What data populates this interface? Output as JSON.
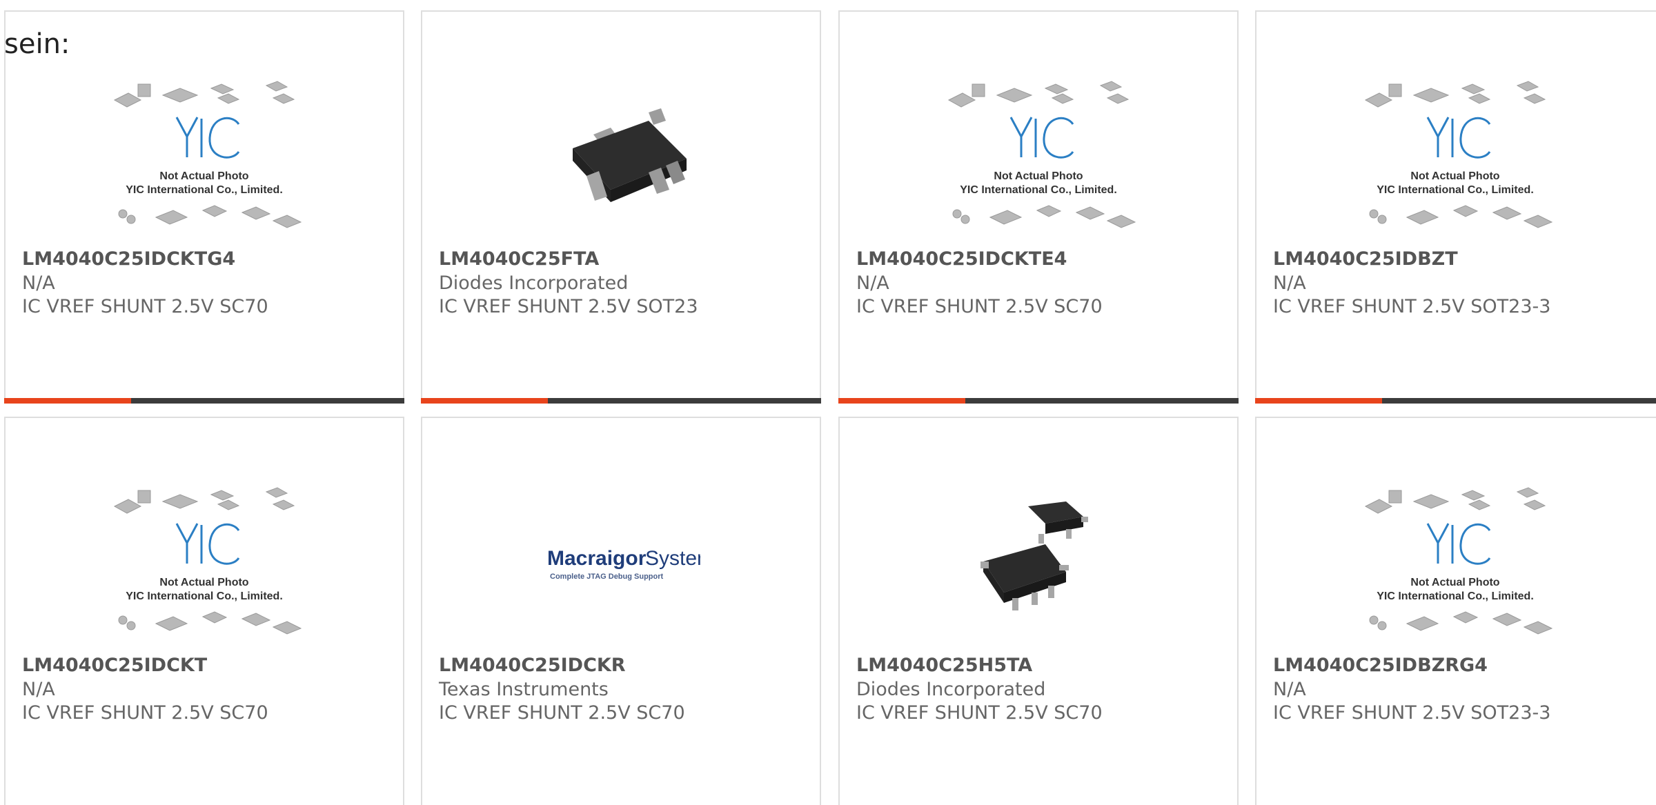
{
  "intro_text": "sein:",
  "colors": {
    "accent": "#e8441c",
    "bar_dark": "#3c3c3c",
    "card_border": "#dedede",
    "logo_blue": "#2b7fc4"
  },
  "placeholder": {
    "logo": "YIC",
    "line1": "Not Actual Photo",
    "line2": "YIC International Co., Limited."
  },
  "macraigor": {
    "brand_a": "Macraigor",
    "brand_b": "Systems",
    "tagline": "Complete JTAG Debug Support"
  },
  "products": [
    {
      "part_number": "LM4040C25IDCKTG4",
      "manufacturer": "N/A",
      "description": "IC VREF SHUNT 2.5V SC70",
      "image": "placeholder-photo"
    },
    {
      "part_number": "LM4040C25FTA",
      "manufacturer": "Diodes Incorporated",
      "description": "IC VREF SHUNT 2.5V SOT23",
      "image": "sot23-chip-photo"
    },
    {
      "part_number": "LM4040C25IDCKTE4",
      "manufacturer": "N/A",
      "description": "IC VREF SHUNT 2.5V SC70",
      "image": "placeholder-photo"
    },
    {
      "part_number": "LM4040C25IDBZT",
      "manufacturer": "N/A",
      "description": "IC VREF SHUNT 2.5V SOT23-3",
      "image": "placeholder-photo"
    },
    {
      "part_number": "LM4040C25IDCKT",
      "manufacturer": "N/A",
      "description": "IC VREF SHUNT 2.5V SC70",
      "image": "placeholder-photo"
    },
    {
      "part_number": "LM4040C25IDCKR",
      "manufacturer": "Texas Instruments",
      "description": "IC VREF SHUNT 2.5V SC70",
      "image": "macraigor-logo"
    },
    {
      "part_number": "LM4040C25H5TA",
      "manufacturer": "Diodes Incorporated",
      "description": "IC VREF SHUNT 2.5V SC70",
      "image": "sc70-chip-photo"
    },
    {
      "part_number": "LM4040C25IDBZRG4",
      "manufacturer": "N/A",
      "description": "IC VREF SHUNT 2.5V SOT23-3",
      "image": "placeholder-photo"
    }
  ]
}
